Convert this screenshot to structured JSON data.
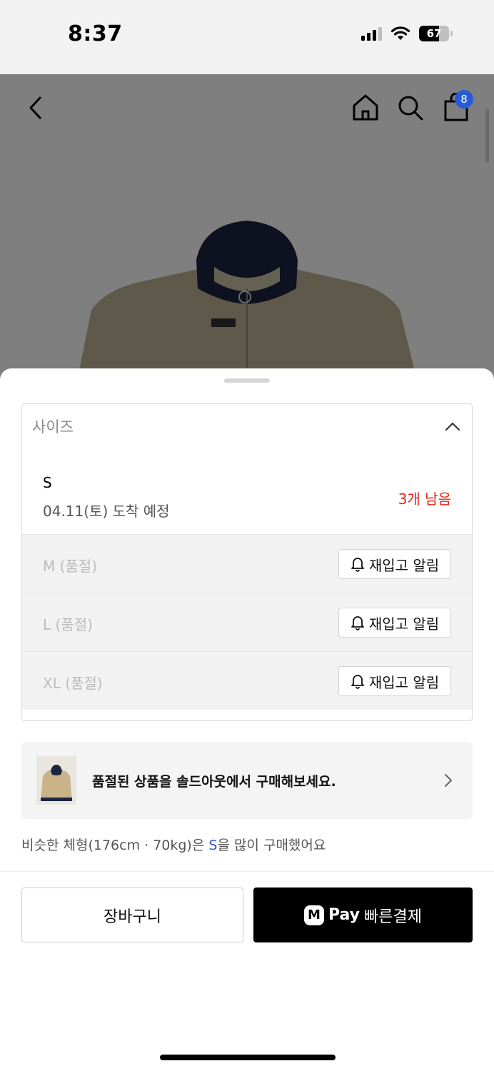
{
  "status_bar": {
    "time": "8:37",
    "battery": "67",
    "battery_level": 0.67
  },
  "header": {
    "icons": [
      "back-icon",
      "home-icon",
      "search-icon",
      "shopping-bag-icon"
    ],
    "cart_count": "8"
  },
  "size_selector": {
    "label": "사이즈",
    "options": [
      {
        "name": "S",
        "eta": "04.11(토) 도착 예정",
        "stock": "3개 남음"
      },
      {
        "name": "M (품절)",
        "restock_label": "재입고 알림"
      },
      {
        "name": "L (품절)",
        "restock_label": "재입고 알림"
      },
      {
        "name": "XL (품절)",
        "restock_label": "재입고 알림"
      }
    ]
  },
  "soldout_banner": {
    "text": "품절된 상품을 솔드아웃에서 구매해보세요."
  },
  "similar": {
    "prefix": "비슷한 체형(176cm · 70kg)은 ",
    "size": "S",
    "suffix": "을 많이 구매했어요"
  },
  "actions": {
    "cart_label": "장바구니",
    "pay_logo": "M",
    "pay_word": "Pay",
    "pay_label": "빠른결제"
  },
  "colors": {
    "accent_blue": "#2a5bd7",
    "stock_red": "#e1251b",
    "pay_bg": "#000000"
  }
}
